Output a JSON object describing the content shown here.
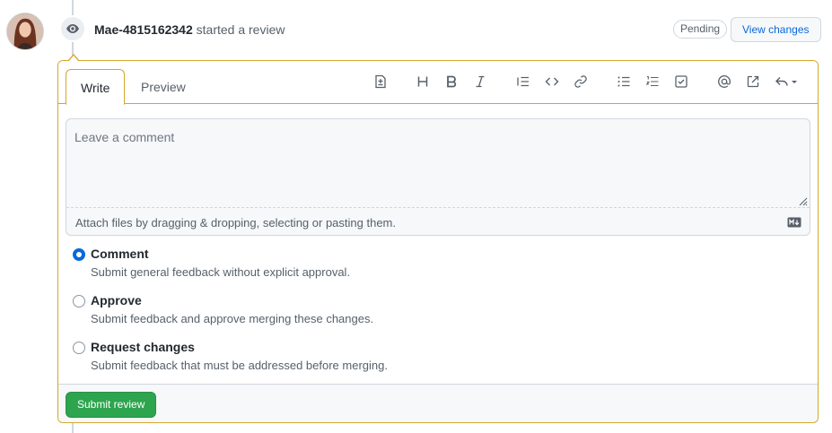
{
  "header": {
    "author": "Mae-4815162342",
    "action_text": "started a review",
    "pending_badge": "Pending",
    "view_changes_label": "View changes"
  },
  "editor": {
    "tabs": [
      {
        "label": "Write",
        "active": true
      },
      {
        "label": "Preview",
        "active": false
      }
    ],
    "toolbar_icons": [
      "add-suggestion-icon",
      "heading-icon",
      "bold-icon",
      "italic-icon",
      "quote-icon",
      "code-icon",
      "link-icon",
      "unordered-list-icon",
      "ordered-list-icon",
      "task-list-icon",
      "mention-icon",
      "cross-reference-icon",
      "saved-replies-icon"
    ],
    "comment_placeholder": "Leave a comment",
    "comment_value": "",
    "attach_text": "Attach files by dragging & dropping, selecting or pasting them.",
    "markdown_icon": "markdown-icon"
  },
  "review_options": [
    {
      "label": "Comment",
      "description": "Submit general feedback without explicit approval.",
      "checked": true
    },
    {
      "label": "Approve",
      "description": "Submit feedback and approve merging these changes.",
      "checked": false
    },
    {
      "label": "Request changes",
      "description": "Submit feedback that must be addressed before merging.",
      "checked": false
    }
  ],
  "footer": {
    "submit_label": "Submit review"
  },
  "colors": {
    "accent_blue": "#0969da",
    "pending_border": "#d4a72c",
    "submit_green": "#2da44e"
  }
}
